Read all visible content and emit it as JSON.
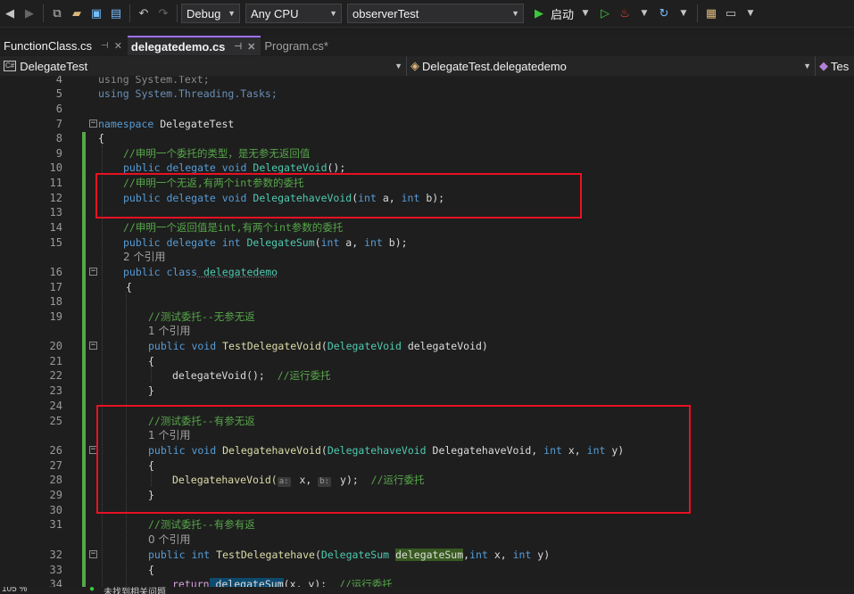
{
  "toolbar": {
    "config": "Debug",
    "platform": "Any CPU",
    "startup_project": "observerTest",
    "start_label": "启动"
  },
  "tabs": [
    {
      "label": "FunctionClass.cs"
    },
    {
      "label": "delegatedemo.cs"
    },
    {
      "label": "Program.cs*"
    }
  ],
  "nav": {
    "project": "DelegateTest",
    "type": "DelegateTest.delegatedemo",
    "member": "Tes"
  },
  "code": {
    "l4": "using System.Text;",
    "l5": "using System.Threading.Tasks;",
    "l7_kw": "namespace",
    "l7_name": " DelegateTest",
    "brace_open": "{",
    "brace_close": "}",
    "l9": "//申明一个委托的类型，是无参无返回值",
    "l10_a": "public delegate void",
    "l10_b": " DelegateVoid",
    "l10_c": "();",
    "l11": "//申明一个无返,有两个int参数的委托",
    "l12_a": "public delegate void",
    "l12_b": " DelegatehaveVoid",
    "l12_c": "(",
    "l12_d": "int",
    "l12_e": " a, ",
    "l12_f": "int",
    "l12_g": " b);",
    "l14": "//申明一个返回值是int,有两个int参数的委托",
    "l15_a": "public delegate int",
    "l15_b": " DelegateSum",
    "l15_c": "(",
    "l15_d": "int",
    "l15_e": " a, ",
    "l15_f": "int",
    "l15_g": " b);",
    "ref2": "2 个引用",
    "l16_a": "public class",
    "l16_b": " delegatedemo",
    "l19": "//测试委托--无参无返",
    "ref1a": "1 个引用",
    "l20_a": "public void",
    "l20_b": " TestDelegateVoid",
    "l20_c": "(",
    "l20_d": "DelegateVoid",
    "l20_e": " delegateVoid)",
    "l22_a": "delegateVoid();",
    "l22_b": "  //运行委托",
    "l25": "//测试委托--有参无返",
    "ref1b": "1 个引用",
    "l26_a": "public void",
    "l26_b": " DelegatehaveVoid",
    "l26_c": "(",
    "l26_d": "DelegatehaveVoid",
    "l26_e": " DelegatehaveVoid, ",
    "l26_f": "int",
    "l26_g": " x, ",
    "l26_h": "int",
    "l26_i": " y)",
    "l28_a": "DelegatehaveVoid(",
    "l28_hint_a": "a:",
    "l28_b": " x, ",
    "l28_hint_b": "b:",
    "l28_c": " y);",
    "l28_d": "  //运行委托",
    "l31": "//测试委托--有参有返",
    "ref0": "0 个引用",
    "l32_a": "public int",
    "l32_b": " TestDelegatehave",
    "l32_c": "(",
    "l32_d": "DelegateSum",
    "l32_e": " ",
    "l32_f": "delegateSum",
    "l32_g": ",",
    "l32_h": "int",
    "l32_i": " x, ",
    "l32_j": "int",
    "l32_k": " y)",
    "l34_a": "return",
    "l34_b": " delegateSum",
    "l34_c": "(x, y);",
    "l34_d": "  //运行委托"
  },
  "line_numbers": [
    "4",
    "5",
    "6",
    "7",
    "8",
    "9",
    "10",
    "11",
    "12",
    "13",
    "14",
    "15",
    "16",
    "17",
    "18",
    "19",
    "20",
    "21",
    "22",
    "23",
    "24",
    "25",
    "26",
    "27",
    "28",
    "29",
    "30",
    "31",
    "32",
    "33",
    "34"
  ],
  "status": {
    "zoom": "105 %",
    "issues": "未找到相关问题"
  },
  "colors": {
    "comment": "#57a64a",
    "keyword": "#569cd6",
    "type": "#4ec9b0",
    "highlight_box": "#e81123"
  }
}
